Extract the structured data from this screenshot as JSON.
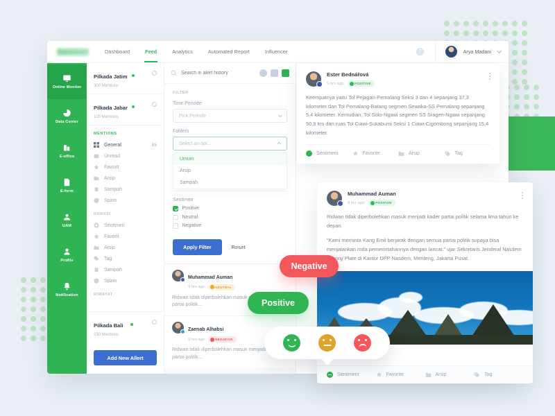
{
  "topnav": {
    "logo_name": "brand-logo",
    "tabs": [
      {
        "label": "Dashboard",
        "active": false
      },
      {
        "label": "Feed",
        "active": true
      },
      {
        "label": "Analytics",
        "active": false
      },
      {
        "label": "Automated Report",
        "active": false
      },
      {
        "label": "Influencer",
        "active": false
      }
    ],
    "help_label": "?",
    "user_name": "Arya Madani"
  },
  "rail": {
    "items": [
      {
        "label": "Online Monitor",
        "icon": "monitor-icon",
        "active": true
      },
      {
        "label": "Data Center",
        "icon": "pie-chart-icon",
        "active": false
      },
      {
        "label": "E-office",
        "icon": "building-icon",
        "active": false
      },
      {
        "label": "E-form",
        "icon": "document-icon",
        "active": false
      },
      {
        "label": "UAM",
        "icon": "users-icon",
        "active": false
      },
      {
        "label": "Profile",
        "icon": "person-icon",
        "active": false
      },
      {
        "label": "Notification",
        "icon": "bell-icon",
        "active": false
      }
    ]
  },
  "alerts": {
    "items": [
      {
        "title": "Pilkada Jatim",
        "mentions": "300 Mentions",
        "status": "online"
      },
      {
        "title": "Pilkada Jabar",
        "mentions": "105 Mentions",
        "status": "online"
      }
    ],
    "mentions_heading": "MENTIONS",
    "mentions_menu": [
      {
        "label": "General",
        "icon": "grid-icon",
        "count": "85",
        "active": true
      },
      {
        "label": "Unread",
        "icon": "mail-icon",
        "count": "",
        "active": false
      },
      {
        "label": "Favorit",
        "icon": "star-icon",
        "count": "",
        "active": false
      },
      {
        "label": "Arsip",
        "icon": "folder-icon",
        "count": "",
        "active": false
      },
      {
        "label": "Sampah",
        "icon": "trash-icon",
        "count": "",
        "active": false
      },
      {
        "label": "Spam",
        "icon": "shield-icon",
        "count": "",
        "active": false
      }
    ],
    "kurasi_heading": "KURASI",
    "kurasi_menu": [
      {
        "label": "Sentimen",
        "icon": "sentiment-icon",
        "count": ""
      },
      {
        "label": "Favorit",
        "icon": "star-icon",
        "count": ""
      },
      {
        "label": "Arsip",
        "icon": "folder-icon",
        "count": ""
      },
      {
        "label": "Tag",
        "icon": "tag-icon",
        "count": ""
      },
      {
        "label": "Sampah",
        "icon": "trash-icon",
        "count": ""
      },
      {
        "label": "Spam",
        "icon": "shield-icon",
        "count": ""
      }
    ],
    "riwayat_heading": "RIWAYAT",
    "bottom_alert": {
      "title": "Pilkada Bali",
      "mentions": "230 Mentions",
      "status": "online"
    },
    "add_button": "Add New Allert"
  },
  "search": {
    "placeholder": "Search in alert history",
    "icon": "search-icon",
    "buttons": [
      "check-circle-icon",
      "archive-icon",
      "calendar-green-icon"
    ]
  },
  "filter": {
    "heading": "FILTER",
    "time_period_label": "Time Periode",
    "time_period_value": "Pick Periode",
    "folders_label": "Folders",
    "folders_value": "Select an opt...",
    "folders_options": [
      "Umum",
      "Arsip",
      "Sampah"
    ],
    "folders_selected": "Umum",
    "sentimen_label": "Sentimen",
    "sentimen_options": [
      {
        "label": "Positive",
        "checked": true
      },
      {
        "label": "Neutral",
        "checked": false
      },
      {
        "label": "Negative",
        "checked": false
      }
    ],
    "apply_label": "Apply Filter",
    "reset_label": "Reset"
  },
  "mini_feed": [
    {
      "name": "Muhammad Auman",
      "time": "9 hrs ago",
      "sentiment": "NEUTRAL",
      "sentiment_class": "neutral",
      "network": "facebook",
      "text": "Ridwan tidak diperbolehkan masuk menjadi kader partai politik..."
    },
    {
      "name": "Zaenab Alhabsi",
      "time": "9 hrs ago",
      "sentiment": "NEGATIVE",
      "sentiment_class": "negative",
      "network": "twitter",
      "text": "Ridwan tidak diperbolehkan masuk menjadi kader partai politik..."
    }
  ],
  "card_ester": {
    "name": "Ester Bednářová",
    "time": "9 hrs ago",
    "sentiment": "POSITIVE",
    "network": "facebook",
    "body": "Keempatnya yaitu Tol Pejagan-Pemalang Seksi 3 dan 4 sepanjang 37,3 kilometer dan Tol Pemalang-Batang segmen Sewaka-SS Pemalang sepanjang 5,4 kilometer. Kemudian, Tol Solo-Ngawi segmen SS Sragen-Ngawi sepanjang 50,9 km dan ruas Tol Ciawi-Sukabumi Seksi 1 Ciawi-Cigombong sepanjang 15,4 kilometer.",
    "actions": [
      {
        "label": "Sentiment",
        "icon": "sentiment-icon"
      },
      {
        "label": "Favorite",
        "icon": "star-icon"
      },
      {
        "label": "Arsip",
        "icon": "folder-icon"
      },
      {
        "label": "Tag",
        "icon": "tag-icon"
      }
    ]
  },
  "card_auman": {
    "name": "Muhammad Auman",
    "time": "9 hrs ago",
    "sentiment": "POSITIVE",
    "network": "facebook",
    "body_p1": "Ridwan tidak diperbolehkan masuk menjadi kader partai politik selama lima tahun ke depan.",
    "body_p2": "\"Kami meminta Kang Emil berjarak dengan semua partai politik supaya bisa menjalankan roda pemerintahannya dengan lancar,\" ujar Sekretaris Jenderal Nasdem Jhonny Plate di Kantor DPP Nasdem, Menteng, Jakarta Pusat.",
    "photo_alt": "mountain-landscape-photo",
    "actions": [
      {
        "label": "Sentiment",
        "icon": "sentiment-icon"
      },
      {
        "label": "Favorite",
        "icon": "star-icon"
      },
      {
        "label": "Arsip",
        "icon": "folder-icon"
      },
      {
        "label": "Tag",
        "icon": "tag-icon"
      }
    ]
  },
  "floating": {
    "pill_negative": "Negative",
    "pill_positive": "Positive",
    "faces": [
      "happy-face-icon",
      "neutral-face-icon",
      "sad-face-icon"
    ]
  },
  "colors": {
    "brand_green": "#2fb355",
    "accent_blue": "#3d6fd1",
    "negative_red": "#f2575c",
    "neutral_orange": "#dfa22c",
    "page_bg": "#e9eff4"
  }
}
